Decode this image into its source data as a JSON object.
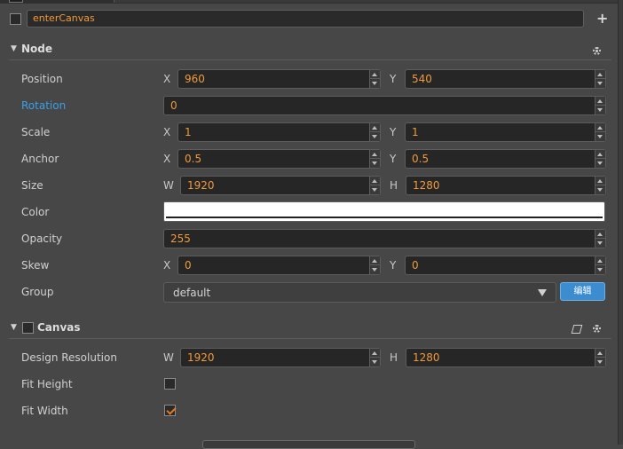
{
  "node_name": "enterCanvas",
  "add_icon": "+",
  "node_section": {
    "title": "Node",
    "position": {
      "label": "Position",
      "x_axis": "X",
      "x": "960",
      "y_axis": "Y",
      "y": "540"
    },
    "rotation": {
      "label": "Rotation",
      "value": "0"
    },
    "scale": {
      "label": "Scale",
      "x_axis": "X",
      "x": "1",
      "y_axis": "Y",
      "y": "1"
    },
    "anchor": {
      "label": "Anchor",
      "x_axis": "X",
      "x": "0.5",
      "y_axis": "Y",
      "y": "0.5"
    },
    "size": {
      "label": "Size",
      "w_axis": "W",
      "w": "1920",
      "h_axis": "H",
      "h": "1280"
    },
    "color": {
      "label": "Color",
      "value": "#ffffff"
    },
    "opacity": {
      "label": "Opacity",
      "value": "255"
    },
    "skew": {
      "label": "Skew",
      "x_axis": "X",
      "x": "0",
      "y_axis": "Y",
      "y": "0"
    },
    "group": {
      "label": "Group",
      "value": "default",
      "edit_label": "编辑"
    }
  },
  "canvas_section": {
    "title": "Canvas",
    "design_resolution": {
      "label": "Design Resolution",
      "w_axis": "W",
      "w": "1920",
      "h_axis": "H",
      "h": "1280"
    },
    "fit_height": {
      "label": "Fit Height",
      "checked": false
    },
    "fit_width": {
      "label": "Fit Width",
      "checked": true
    }
  },
  "colors": {
    "accent_value": "#ef9a3c",
    "link": "#3a9fe8",
    "button": "#3c8cd0",
    "background": "#474747"
  }
}
